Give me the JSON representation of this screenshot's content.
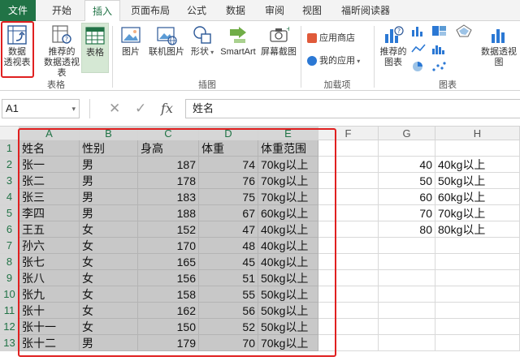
{
  "tabs": [
    "文件",
    "开始",
    "插入",
    "页面布局",
    "公式",
    "数据",
    "审阅",
    "视图",
    "福昕阅读器"
  ],
  "ribbon": {
    "pivot_table": "数据\n透视表",
    "recommended_pivot": "推荐的\n数据透视表",
    "table": "表格",
    "picture": "图片",
    "online_picture": "联机图片",
    "shapes": "形状",
    "smartart": "SmartArt",
    "screenshot": "屏幕截图",
    "app_store": "应用商店",
    "my_apps": "我的应用",
    "recommended_charts": "推荐的\n图表",
    "pivot_chart": "数据透视图",
    "groups": {
      "tables": "表格",
      "illustrations": "插图",
      "addins": "加载项",
      "charts": "图表"
    }
  },
  "formula_bar": {
    "name_box": "A1",
    "fx": "fx",
    "content": "姓名"
  },
  "columns": [
    "A",
    "B",
    "C",
    "D",
    "E",
    "F",
    "G",
    "H"
  ],
  "rows": [
    "1",
    "2",
    "3",
    "4",
    "5",
    "6",
    "7",
    "8",
    "9",
    "10",
    "11",
    "12",
    "13"
  ],
  "table": [
    [
      "姓名",
      "性别",
      "身高",
      "体重",
      "体重范围"
    ],
    [
      "张一",
      "男",
      "187",
      "74",
      "70kg以上"
    ],
    [
      "张二",
      "男",
      "178",
      "76",
      "70kg以上"
    ],
    [
      "张三",
      "男",
      "183",
      "75",
      "70kg以上"
    ],
    [
      "李四",
      "男",
      "188",
      "67",
      "60kg以上"
    ],
    [
      "王五",
      "女",
      "152",
      "47",
      "40kg以上"
    ],
    [
      "孙六",
      "女",
      "170",
      "48",
      "40kg以上"
    ],
    [
      "张七",
      "女",
      "165",
      "45",
      "40kg以上"
    ],
    [
      "张八",
      "女",
      "156",
      "51",
      "50kg以上"
    ],
    [
      "张九",
      "女",
      "158",
      "55",
      "50kg以上"
    ],
    [
      "张十",
      "女",
      "162",
      "56",
      "50kg以上"
    ],
    [
      "张十一",
      "女",
      "150",
      "52",
      "50kg以上"
    ],
    [
      "张十二",
      "男",
      "179",
      "70",
      "70kg以上"
    ]
  ],
  "lookup": [
    [
      "40",
      "40kg以上"
    ],
    [
      "50",
      "50kg以上"
    ],
    [
      "60",
      "60kg以上"
    ],
    [
      "70",
      "70kg以上"
    ],
    [
      "80",
      "80kg以上"
    ]
  ]
}
